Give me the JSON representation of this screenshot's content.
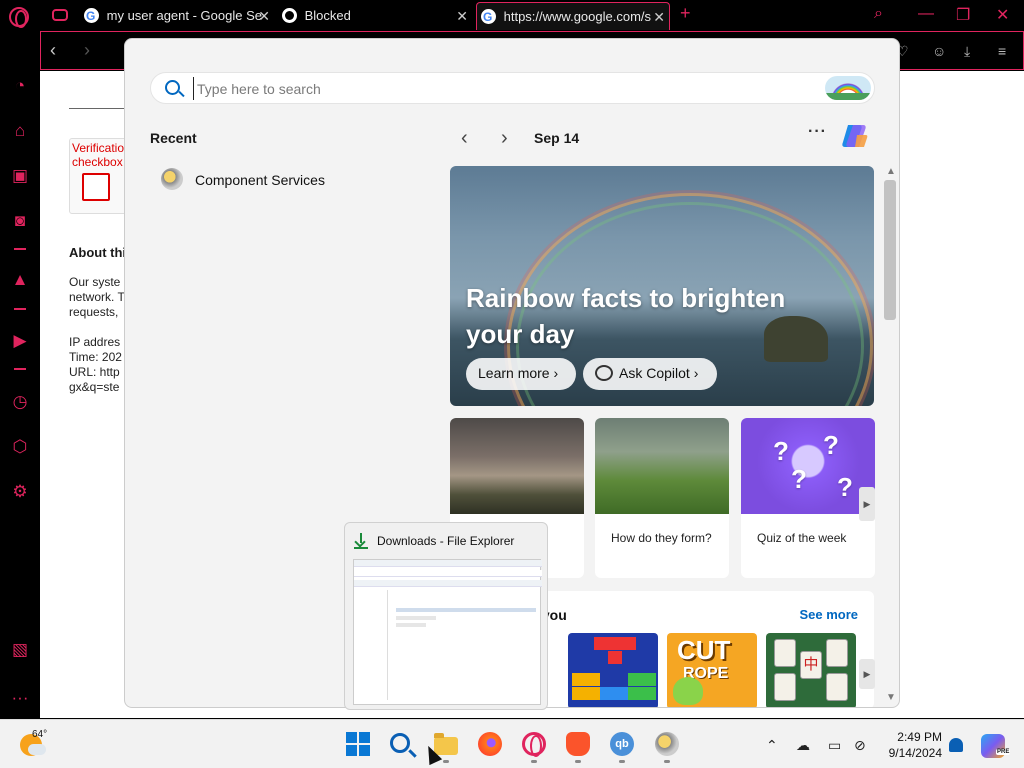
{
  "browser": {
    "tabs": [
      {
        "title": "my user agent - Google Se",
        "icon": "google-icon"
      },
      {
        "title": "Blocked",
        "icon": "globe-icon"
      },
      {
        "title": "https://www.google.com/s",
        "icon": "google-icon"
      }
    ],
    "accent": "#e0245e"
  },
  "page": {
    "captcha_label": "Verification checkbox",
    "about_heading": "About thi",
    "para1": "Our syste\nnetwork. T\nrequests,",
    "para2": "IP addres\nTime: 202\nURL: http\ngx&q=ste"
  },
  "flyout": {
    "search_placeholder": "Type here to search",
    "recent_title": "Recent",
    "recent_items": [
      {
        "label": "Component Services",
        "icon": "component-services-icon"
      }
    ],
    "date": "Sep 14",
    "more": "···",
    "hero": {
      "title": "Rainbow facts to brighten your day",
      "learn_more": "Learn more",
      "ask_copilot": "Ask Copilot",
      "chevron": "›"
    },
    "cards": [
      {
        "text": ""
      },
      {
        "text": "How do they form?"
      },
      {
        "text": "Quiz of the week"
      }
    ],
    "games_title": "or you",
    "see_more": "See more",
    "game_tiles": {
      "cut_text": "CUT",
      "rope_text": "ROPE",
      "mahjong_char": "中"
    }
  },
  "downloads_preview": {
    "title": "Downloads - File Explorer",
    "more": "..."
  },
  "taskbar": {
    "temperature": "64°",
    "time": "2:49 PM",
    "date": "9/14/2024",
    "copilot_badge": "PRE",
    "qb_label": "qb"
  }
}
